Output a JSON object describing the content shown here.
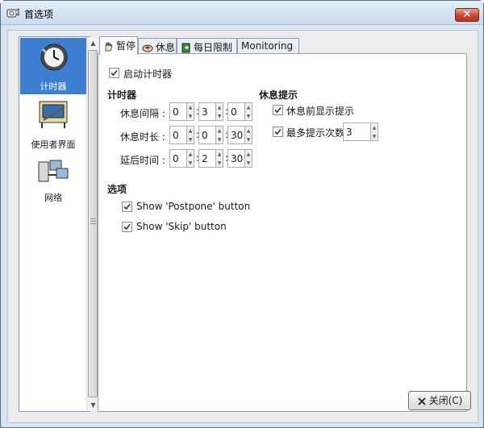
{
  "window": {
    "title": "首选项",
    "close_glyph": "×"
  },
  "sidebar": {
    "items": [
      {
        "label": "计时器",
        "icon": "clock-icon",
        "selected": true
      },
      {
        "label": "使用者界面",
        "icon": "drawing-board-icon",
        "selected": false
      },
      {
        "label": "网络",
        "icon": "network-computers-icon",
        "selected": false
      }
    ]
  },
  "tabs": [
    {
      "label": "暂停",
      "icon": "hand-icon",
      "active": true
    },
    {
      "label": "休息",
      "icon": "cup-icon",
      "active": false
    },
    {
      "label": "每日限制",
      "icon": "door-icon",
      "active": false
    },
    {
      "label": "Monitoring",
      "icon": "",
      "active": false
    }
  ],
  "pause_tab": {
    "enable_timer": {
      "label": "启动计时器",
      "checked": true
    },
    "timers": {
      "header": "计时器",
      "rows": [
        {
          "label": "休息间隔 :",
          "hours": "0",
          "minutes": "3",
          "seconds": "0"
        },
        {
          "label": "休息时长 :",
          "hours": "0",
          "minutes": "0",
          "seconds": "30"
        },
        {
          "label": "延后时间 :",
          "hours": "0",
          "minutes": "2",
          "seconds": "30"
        }
      ]
    },
    "break_prompt": {
      "header": "休息提示",
      "show_prompt": {
        "label": "休息前显示提示",
        "checked": true
      },
      "max_prompts": {
        "label": "最多提示次数",
        "checked": true,
        "value": "3"
      }
    },
    "options": {
      "header": "选项",
      "show_postpone": {
        "label": "Show 'Postpone' button",
        "checked": true
      },
      "show_skip": {
        "label": "Show 'Skip' button",
        "checked": true
      }
    }
  },
  "footer": {
    "close_label": "关闭(C)"
  },
  "colors": {
    "selection": "#3d7fd0",
    "titlebar": "#cbdcee",
    "close_button": "#c54a33"
  }
}
